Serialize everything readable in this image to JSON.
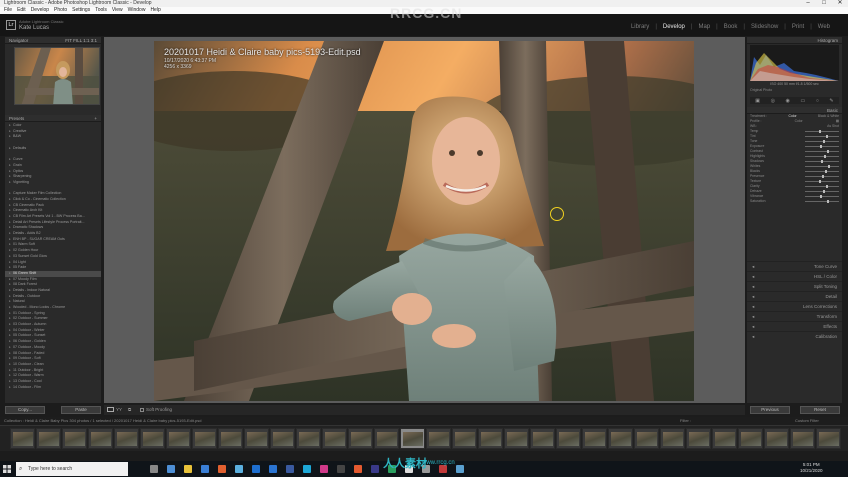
{
  "titlebar": {
    "text": "Lightroom Classic - Adobe Photoshop Lightroom Classic - Develop",
    "minimize": "–",
    "maximize": "□",
    "close": "✕"
  },
  "menu": [
    "File",
    "Edit",
    "Develop",
    "Photo",
    "Settings",
    "Tools",
    "View",
    "Window",
    "Help"
  ],
  "identity": {
    "line1": "Adobe Lightroom Classic",
    "line2": "Kate Lucas",
    "logo": "Lr"
  },
  "watermark_top": "RRCG.CN",
  "modules": [
    "Library",
    "Develop",
    "Map",
    "Book",
    "Slideshow",
    "Print",
    "Web"
  ],
  "active_module": "Develop",
  "left_panel": {
    "navigator_label": "Navigator",
    "navigator_zoom": "FIT  FILL  1:1  3:1",
    "presets_label": "Presets",
    "presets": [
      {
        "label": "Color",
        "sel": false
      },
      {
        "label": "Creative",
        "sel": false
      },
      {
        "label": "B&W",
        "sel": false
      },
      {
        "label": "",
        "sel": false
      },
      {
        "label": "Defaults",
        "sel": false
      },
      {
        "label": "",
        "sel": false
      },
      {
        "label": "Curve",
        "sel": false
      },
      {
        "label": "Grain",
        "sel": false
      },
      {
        "label": "Optics",
        "sel": false
      },
      {
        "label": "Sharpening",
        "sel": false
      },
      {
        "label": "Vignetting",
        "sel": false
      },
      {
        "label": "",
        "sel": false
      },
      {
        "label": "Capture Maker Film Collection",
        "sel": false
      },
      {
        "label": "Click & Co - Cinematic Collection",
        "sel": false
      },
      {
        "label": "CB Cinematic Pack",
        "sel": false
      },
      {
        "label": "Cinematic Arch Kit",
        "sel": false
      },
      {
        "label": "CB Film Art Presets Vol 1 - BW Process Ba...",
        "sel": false
      },
      {
        "label": "Detail Art Presets Lifestyle Process Portrait...",
        "sel": false
      },
      {
        "label": "Dramatic Shadows",
        "sel": false
      },
      {
        "label": "Details - Adds B2",
        "sel": false
      },
      {
        "label": "ENH BP - SUGAR CREAM Outs",
        "sel": false
      },
      {
        "label": "01 Warm Soft",
        "sel": false
      },
      {
        "label": "02 Golden Hour",
        "sel": false
      },
      {
        "label": "03 Sunset Gold Glow",
        "sel": false
      },
      {
        "label": "04 Light",
        "sel": false
      },
      {
        "label": "05 Fade",
        "sel": false
      },
      {
        "label": "06 Green Shift",
        "sel": true
      },
      {
        "label": "07 Moody Film",
        "sel": false
      },
      {
        "label": "08 Dark Forest",
        "sel": false
      },
      {
        "label": "Details - Indoor Natural",
        "sel": false
      },
      {
        "label": "Details - Outdoor",
        "sel": false
      },
      {
        "label": "Natural",
        "sel": false
      },
      {
        "label": "Wooded - Mono Looks - Chrome",
        "sel": false
      },
      {
        "label": "01 Outdoor - Spring",
        "sel": false
      },
      {
        "label": "02 Outdoor - Summer",
        "sel": false
      },
      {
        "label": "03 Outdoor - Autumn",
        "sel": false
      },
      {
        "label": "04 Outdoor - Winter",
        "sel": false
      },
      {
        "label": "05 Outdoor - Sunset",
        "sel": false
      },
      {
        "label": "06 Outdoor - Golden",
        "sel": false
      },
      {
        "label": "07 Outdoor - Moody",
        "sel": false
      },
      {
        "label": "08 Outdoor - Faded",
        "sel": false
      },
      {
        "label": "09 Outdoor - Soft",
        "sel": false
      },
      {
        "label": "10 Outdoor - Clean",
        "sel": false
      },
      {
        "label": "11 Outdoor - Bright",
        "sel": false
      },
      {
        "label": "12 Outdoor - Warm",
        "sel": false
      },
      {
        "label": "13 Outdoor - Cool",
        "sel": false
      },
      {
        "label": "14 Outdoor - Film",
        "sel": false
      }
    ],
    "copy_button": "Copy...",
    "paste_button": "Paste"
  },
  "photo": {
    "title": "20201017 Heidi & Claire baby pics-5193-Edit.psd",
    "line2": "10/17/2020 6:43:37 PM",
    "line3": "4256 x 3369"
  },
  "toolbar": {
    "soft_proofing": "Soft Proofing"
  },
  "right_panel": {
    "histogram_label": "Histogram",
    "hist_values": "ISO 400   50 mm   f/1.8   1/500 sec",
    "original_photo": "Original Photo",
    "basic_label": "Basic",
    "treatment_label": "Treatment :",
    "treatment_color": "Color",
    "treatment_bw": "Black & White",
    "profile_label": "Profile :",
    "profile_value": "Color",
    "wb_label": "WB :",
    "wb_value": "As Shot",
    "sliders_basic": [
      "Temp",
      "Tint",
      "Tone",
      "Exposure",
      "Contrast",
      "Highlights",
      "Shadows",
      "Whites",
      "Blacks",
      "Presence",
      "Texture",
      "Clarity",
      "Dehaze",
      "Vibrance",
      "Saturation"
    ],
    "tone_label": "Tone",
    "auto_label": "Auto",
    "sections": [
      "Tone Curve",
      "HSL / Color",
      "Split Toning",
      "Detail",
      "Lens Corrections",
      "Transform",
      "Effects",
      "Calibration"
    ],
    "previous_button": "Previous",
    "reset_button": "Reset"
  },
  "filmstrip": {
    "info": "Collection : Heidi & Claire Baby Pics    304 photos / 1 selected / 20201017 Heidi & Claire baby pics-5193-Edit.psd",
    "filter_label": "Filter :",
    "filter_value": "Custom Filter",
    "count": 32,
    "selected_index": 15
  },
  "taskbar": {
    "search_placeholder": "Type here to search",
    "time": "5:01 PM",
    "date": "10/21/2020"
  },
  "watermark_bottom": "人人素材",
  "watermark_bottom2": "www.rrcg.cn",
  "colors": {
    "accent": "#2fb6c4",
    "panel": "#2a2a2a",
    "center": "#5c5c5c"
  }
}
